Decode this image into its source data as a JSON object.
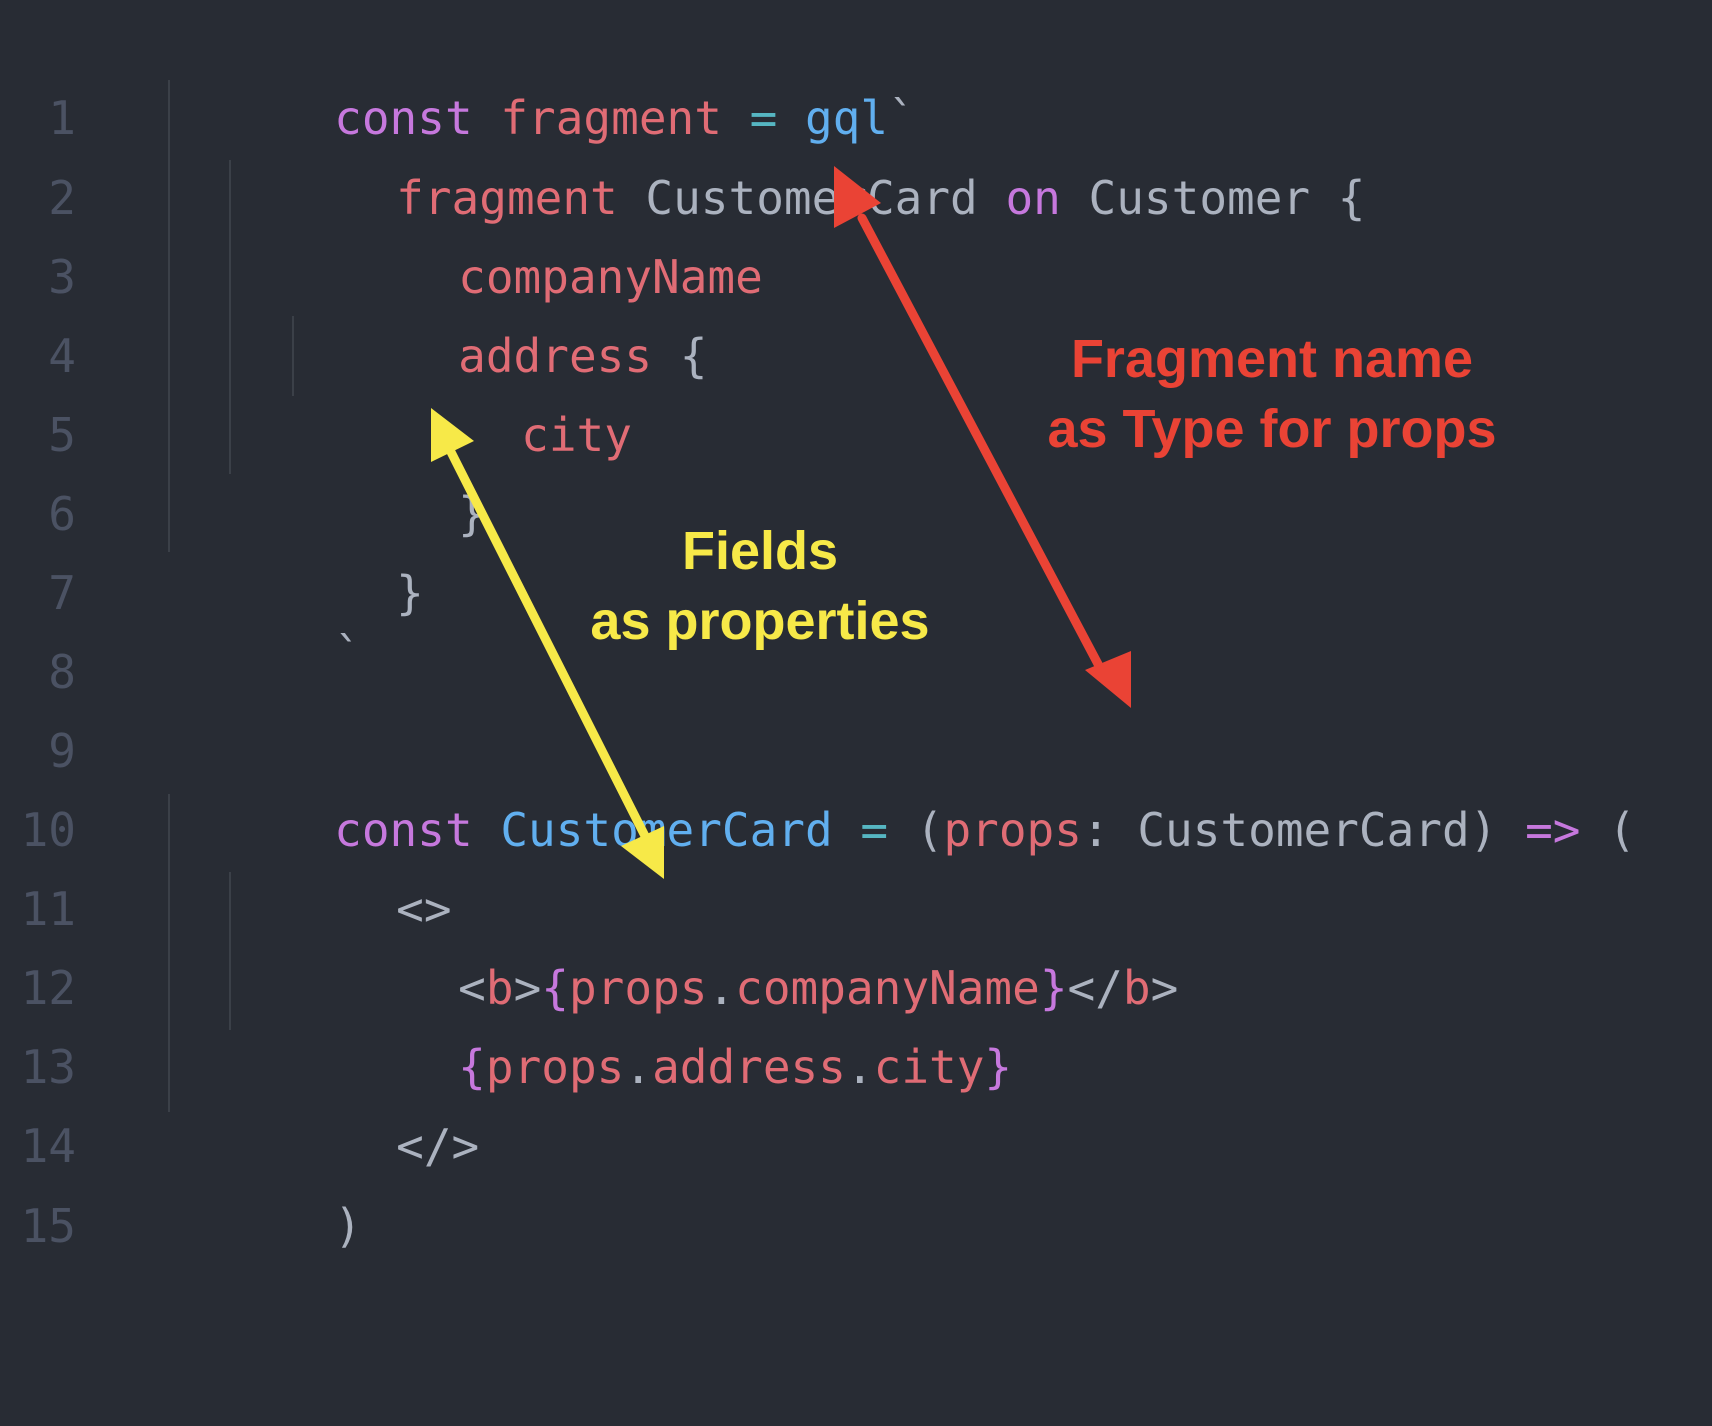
{
  "editor": {
    "lines": [
      {
        "n": "1",
        "tokens": [
          [
            "kw",
            "const "
          ],
          [
            "var",
            "fragment "
          ],
          [
            "op",
            "= "
          ],
          [
            "fn",
            "gql"
          ],
          [
            "pl",
            "`"
          ]
        ]
      },
      {
        "n": "2",
        "tokens": [
          [
            "var",
            "fragment "
          ],
          [
            "pl",
            "CustomerCard "
          ],
          [
            "kw",
            "on "
          ],
          [
            "pl",
            "Customer {"
          ]
        ]
      },
      {
        "n": "3",
        "tokens": [
          [
            "var",
            "companyName"
          ]
        ]
      },
      {
        "n": "4",
        "tokens": [
          [
            "var",
            "address "
          ],
          [
            "pl",
            "{"
          ]
        ]
      },
      {
        "n": "5",
        "tokens": [
          [
            "var",
            "city"
          ]
        ]
      },
      {
        "n": "6",
        "tokens": [
          [
            "pl",
            "}"
          ]
        ]
      },
      {
        "n": "7",
        "tokens": [
          [
            "pl",
            "}"
          ]
        ]
      },
      {
        "n": "8",
        "tokens": [
          [
            "pl",
            "`"
          ]
        ]
      },
      {
        "n": "9",
        "tokens": []
      },
      {
        "n": "10",
        "tokens": [
          [
            "kw",
            "const "
          ],
          [
            "fn",
            "CustomerCard "
          ],
          [
            "op",
            "= "
          ],
          [
            "pl",
            "("
          ],
          [
            "var",
            "props"
          ],
          [
            "pl",
            ": CustomerCard) "
          ],
          [
            "kw",
            "=>"
          ],
          [
            "pl",
            " ("
          ]
        ]
      },
      {
        "n": "11",
        "tokens": [
          [
            "pl",
            "<>"
          ]
        ]
      },
      {
        "n": "12",
        "tokens": [
          [
            "pl",
            "<"
          ],
          [
            "var",
            "b"
          ],
          [
            "pl",
            ">"
          ],
          [
            "kw",
            "{"
          ],
          [
            "var",
            "props"
          ],
          [
            "pl",
            "."
          ],
          [
            "var",
            "companyName"
          ],
          [
            "kw",
            "}"
          ],
          [
            "pl",
            "</"
          ],
          [
            "var",
            "b"
          ],
          [
            "pl",
            ">"
          ]
        ]
      },
      {
        "n": "13",
        "tokens": [
          [
            "kw",
            "{"
          ],
          [
            "var",
            "props"
          ],
          [
            "pl",
            "."
          ],
          [
            "var",
            "address"
          ],
          [
            "pl",
            "."
          ],
          [
            "var",
            "city"
          ],
          [
            "kw",
            "}"
          ]
        ]
      },
      {
        "n": "14",
        "tokens": [
          [
            "pl",
            "</>"
          ]
        ]
      },
      {
        "n": "15",
        "tokens": [
          [
            "pl",
            ")"
          ]
        ]
      }
    ]
  },
  "annotations": {
    "fragment_note": {
      "line1": "Fragment name",
      "line2": "as Type for props",
      "color": "#ea4335"
    },
    "fields_note": {
      "line1": "Fields",
      "line2": "as properties",
      "color": "#f7e948"
    }
  },
  "colors": {
    "background": "#282c34",
    "gutter": "#4b5263",
    "keyword": "#c678dd",
    "variable": "#e06c75",
    "function": "#61afef",
    "operator": "#56b6c2",
    "plain": "#abb2bf"
  }
}
